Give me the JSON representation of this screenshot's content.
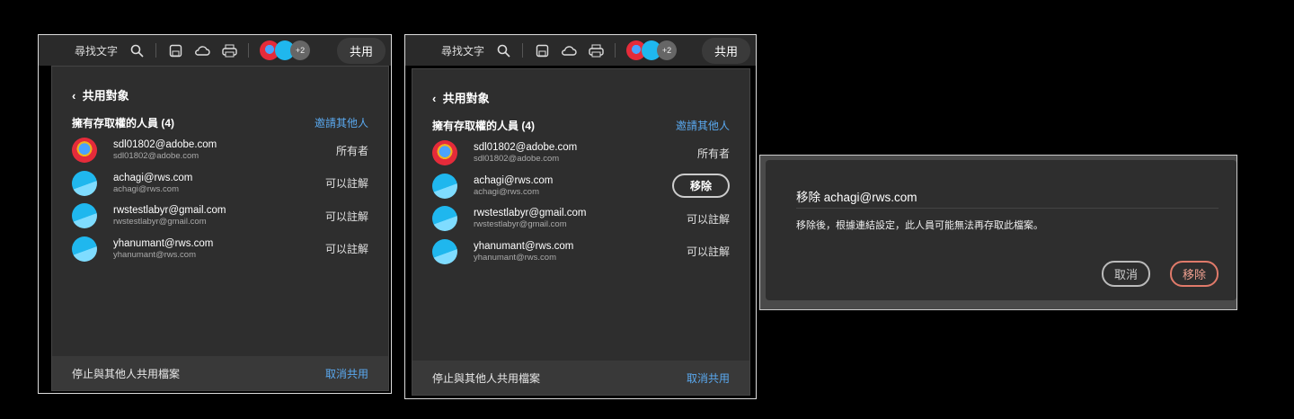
{
  "toolbar": {
    "find_text": "尋找文字",
    "more_count": "+2",
    "share": "共用"
  },
  "panel": {
    "back_title": "共用對象",
    "section": "擁有存取權的人員 (4)",
    "invite": "邀請其他人",
    "footer_text": "停止與其他人共用檔案",
    "unshare": "取消共用",
    "remove": "移除",
    "people": [
      {
        "name": "sdl01802@adobe.com",
        "email": "sdl01802@adobe.com",
        "role": "所有者",
        "avatar": "red"
      },
      {
        "name": "achagi@rws.com",
        "email": "achagi@rws.com",
        "role": "可以註解",
        "avatar": "blue"
      },
      {
        "name": "rwstestlabyr@gmail.com",
        "email": "rwstestlabyr@gmail.com",
        "role": "可以註解",
        "avatar": "blue"
      },
      {
        "name": "yhanumant@rws.com",
        "email": "yhanumant@rws.com",
        "role": "可以註解",
        "avatar": "blue"
      }
    ]
  },
  "dialog": {
    "title": "移除 achagi@rws.com",
    "message": "移除後，根據連結設定，此人員可能無法再存取此檔案。",
    "cancel": "取消",
    "confirm": "移除"
  }
}
